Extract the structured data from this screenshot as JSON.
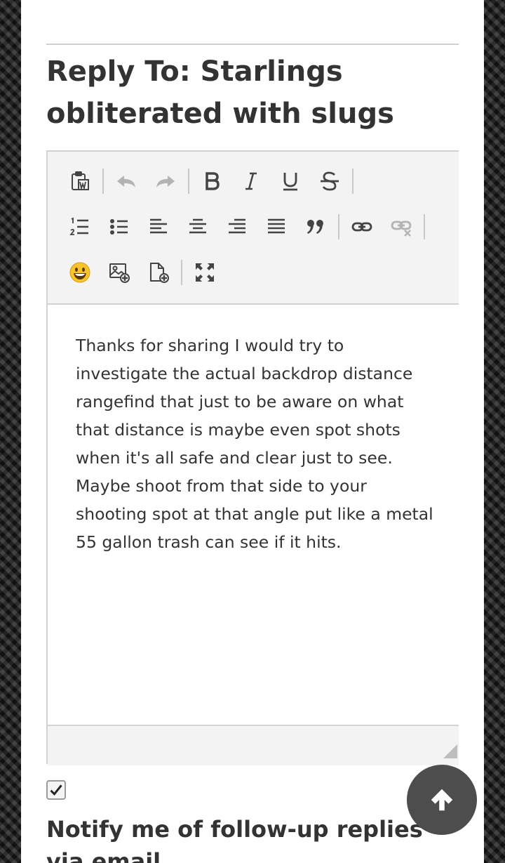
{
  "reply": {
    "title": "Reply To: Starlings obliterated with slugs"
  },
  "toolbar": {
    "row1": [
      "paste-word-icon",
      "undo-icon",
      "redo-icon",
      "bold-icon",
      "italic-icon",
      "underline-icon",
      "strikethrough-icon"
    ],
    "row2": [
      "numbered-list-icon",
      "bullet-list-icon",
      "align-left-icon",
      "align-center-icon",
      "align-right-icon",
      "justify-icon",
      "blockquote-icon",
      "link-icon",
      "unlink-icon"
    ],
    "row3": [
      "emoticon-icon",
      "insert-image-icon",
      "insert-file-icon",
      "fullscreen-icon"
    ]
  },
  "editor": {
    "content": "Thanks for sharing I would try to investigate the actual backdrop distance rangefind that just to be aware on what that distance is maybe even spot shots when it's all safe and clear just to see. Maybe shoot from that side to your shooting spot at that angle put like a metal 55 gallon trash can see if it hits."
  },
  "notify": {
    "checked": true,
    "label": "Notify me of follow-up replies via email"
  },
  "colors": {
    "text": "#333333",
    "toolbar_bg": "#f3f3f3",
    "icon": "#444444",
    "icon_disabled": "#b3b3b3",
    "scroll_button": "#4d4d4d"
  }
}
